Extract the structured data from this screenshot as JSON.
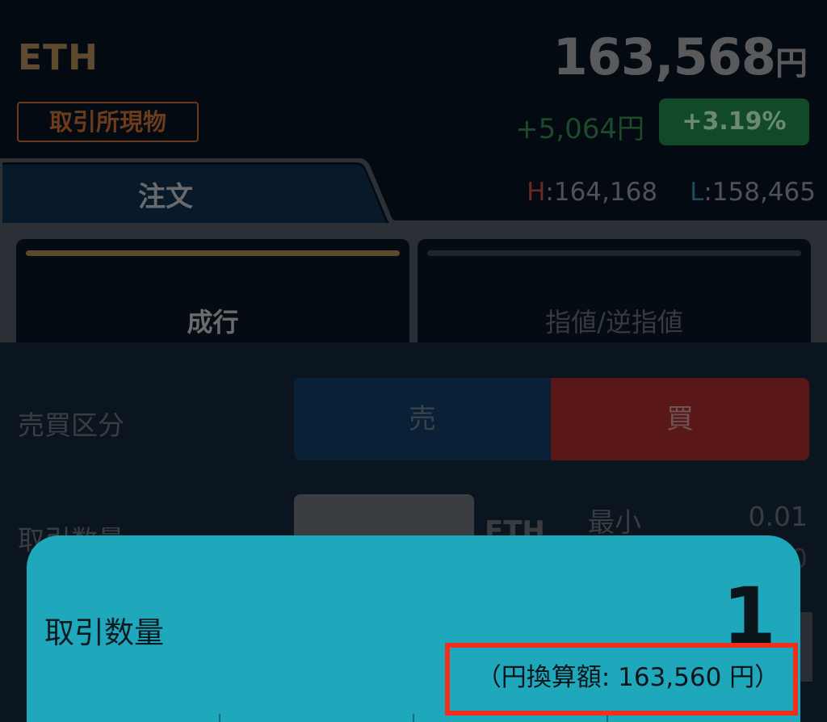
{
  "header": {
    "symbol": "ETH",
    "market_badge": "取引所現物",
    "price": "163,568",
    "price_unit": "円",
    "change_abs": "+5,064",
    "change_abs_unit": "円",
    "change_pct": "+3.19%"
  },
  "tabs": {
    "order_label": "注文",
    "high_label": "H",
    "high_value": "164,168",
    "low_label": "L",
    "low_value": "158,465"
  },
  "order_types": {
    "market": "成行",
    "limit": "指値/逆指値"
  },
  "form": {
    "side_label": "売買区分",
    "sell": "売",
    "buy": "買",
    "qty_label": "取引数量",
    "qty_unit": "ETH",
    "min_label": "最小",
    "min_value": "0.01"
  },
  "qty_card": {
    "label": "取引数量",
    "value": "1",
    "conversion": "（円換算額: 163,560 円）"
  },
  "colors": {
    "accent_card": "#1fa7bc",
    "highlight": "#f0301c",
    "buy": "#5a1718",
    "sell": "#0a2036",
    "up_green": "#124a29"
  }
}
